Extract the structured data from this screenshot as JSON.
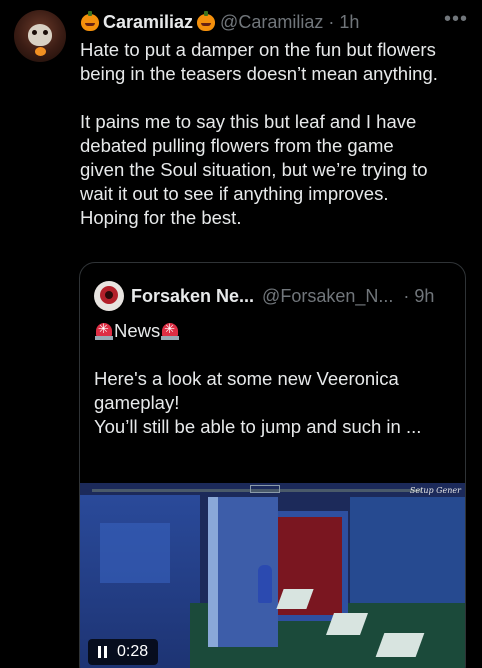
{
  "tweet": {
    "display_name": "Caramiliaz",
    "handle": "@Caramiliaz",
    "time": "· 1h",
    "more_label": "•••",
    "text_paragraph_1": "Hate to put a damper on the fun but flowers\nbeing in the teasers doesn’t mean anything.",
    "text_paragraph_2": "It pains me to say this but leaf and I have\ndebated pulling flowers from the game\ngiven the Soul situation, but we’re trying to\nwait it out to see if anything improves.\nHoping for the best."
  },
  "quote": {
    "display_name": "Forsaken Ne...",
    "handle": "@Forsaken_N...",
    "time": "· 9h",
    "news_label": "News",
    "body_line_1": "Here's a look at some new Veeronica",
    "body_line_2": "gameplay!",
    "body_line_3": "You’ll still be able to jump and such in ...",
    "video": {
      "duration": "0:28",
      "objective_text": "Setup Gener"
    }
  },
  "icons": {
    "pumpkin": "jack-o-lantern-emoji",
    "siren": "police-light-emoji",
    "pause": "pause-icon"
  }
}
